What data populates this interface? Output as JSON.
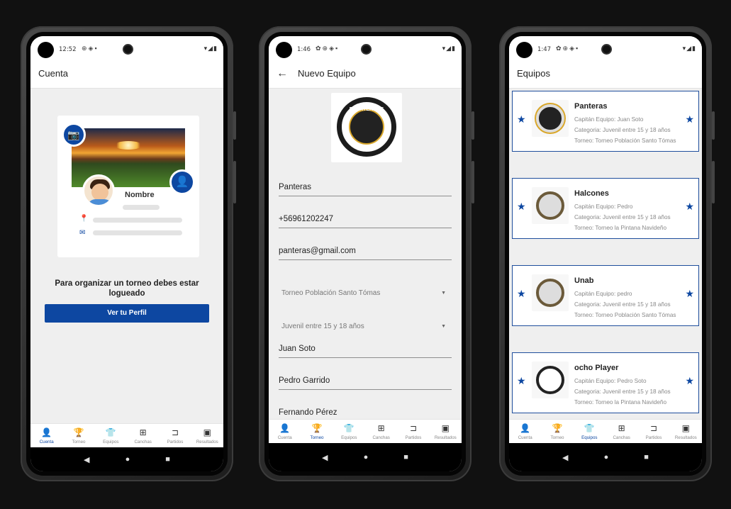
{
  "nav_items": [
    {
      "label": "Cuenta",
      "icon": "person-icon"
    },
    {
      "label": "Torneo",
      "icon": "trophy-icon"
    },
    {
      "label": "Equipos",
      "icon": "shirt-icon"
    },
    {
      "label": "Canchas",
      "icon": "field-icon"
    },
    {
      "label": "Partidos",
      "icon": "bracket-icon"
    },
    {
      "label": "Resultados",
      "icon": "scoreboard-icon"
    }
  ],
  "screen1": {
    "time": "12:52",
    "title": "Cuenta",
    "profile_name": "Nombre",
    "login_message": "Para organizar un torneo debes estar logueado",
    "profile_button": "Ver tu Perfil",
    "active_nav": "Cuenta"
  },
  "screen2": {
    "time": "1:46",
    "title": "Nuevo Equipo",
    "logo_text": "PANHTEROUS",
    "fields": {
      "team_name": "Panteras",
      "phone": "+56961202247",
      "email": "panteras@gmail.com",
      "tournament": "Torneo Población Santo Tómas",
      "category": "Juvenil entre 15 y 18 años",
      "player1": "Juan Soto",
      "player2": "Pedro Garrido",
      "player3": "Fernando Pérez"
    },
    "active_nav": "Torneo"
  },
  "screen3": {
    "time": "1:47",
    "title": "Equipos",
    "teams": [
      {
        "name": "Panteras",
        "captain": "Capitán Equipo: Juan Soto",
        "category": "Categoria: Juvenil entre 15 y 18 años",
        "tournament": "Torneo: Torneo Población Santo Tómas"
      },
      {
        "name": "Halcones",
        "captain": "Capitán Equipo: Pedro",
        "category": "Categoria: Juvenil entre 15 y 18 años",
        "tournament": "Torneo: Torneo la Pintana Navideño"
      },
      {
        "name": "Unab",
        "captain": "Capitán Equipo: pedro",
        "category": "Categoria: Juvenil entre 15 y 18 años",
        "tournament": "Torneo: Torneo Población Santo Tómas"
      },
      {
        "name": "ocho Player",
        "captain": "Capitán Equipo: Pedro Soto",
        "category": "Categoria: Juvenil entre 15 y 18 años",
        "tournament": "Torneo: Torneo la Pintana Navideño"
      }
    ],
    "active_nav": "Equipos"
  },
  "colors": {
    "primary": "#0d47a1",
    "background": "#111111",
    "screen_bg": "#efefef"
  }
}
